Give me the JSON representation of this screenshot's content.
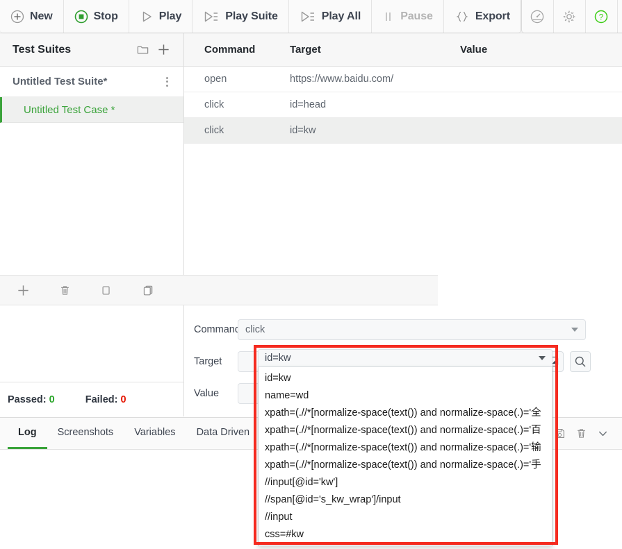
{
  "toolbar": {
    "buttons": [
      {
        "label": "New",
        "icon": "plus-circle-icon",
        "disabled": false
      },
      {
        "label": "Stop",
        "icon": "stop-circle-icon",
        "disabled": false
      },
      {
        "label": "Play",
        "icon": "play-triangle-icon",
        "disabled": false
      },
      {
        "label": "Play Suite",
        "icon": "play-list-icon",
        "disabled": false
      },
      {
        "label": "Play All",
        "icon": "play-list-icon",
        "disabled": false
      },
      {
        "label": "Pause",
        "icon": "pause-icon",
        "disabled": true
      },
      {
        "label": "Export",
        "icon": "braces-icon",
        "disabled": false
      }
    ],
    "right_icons": [
      "speedometer-icon",
      "gear-icon",
      "help-circle-icon",
      "github-icon"
    ],
    "colors": {
      "stop_green": "#3aa33a",
      "help_green": "#3ecd17",
      "label": "#3d4450",
      "disabled": "#b4b4b4"
    }
  },
  "sidebar": {
    "title": "Test Suites",
    "header_icons": [
      "new-folder-icon",
      "add-icon"
    ],
    "suite": {
      "name": "Untitled Test Suite*",
      "menu_icon": "kebab-menu-icon"
    },
    "test_case": {
      "name": "Untitled Test Case *",
      "selected": true,
      "accent": "#3aa33a"
    },
    "status": {
      "passed_label": "Passed:",
      "passed_count": "0",
      "failed_label": "Failed:",
      "failed_count": "0",
      "passed_color": "#2aa52a",
      "failed_color": "#e51400"
    }
  },
  "test_table": {
    "columns": [
      "Command",
      "Target",
      "Value"
    ],
    "rows": [
      {
        "command": "open",
        "target": "https://www.baidu.com/",
        "value": "",
        "selected": false
      },
      {
        "command": "click",
        "target": "id=head",
        "value": "",
        "selected": false
      },
      {
        "command": "click",
        "target": "id=kw",
        "value": "",
        "selected": true
      }
    ],
    "row_actions": [
      "add-command-icon",
      "delete-command-icon",
      "copy-command-icon",
      "paste-command-icon"
    ]
  },
  "form": {
    "command_label": "Command",
    "command_value": "click",
    "target_label": "Target",
    "target_value": "id=kw",
    "value_label": "Value",
    "value_value": "",
    "select_element_icon": "select-element-icon",
    "find_element_icon": "find-element-icon"
  },
  "target_dropdown": {
    "open": true,
    "selected": "id=kw",
    "highlight_color": "#f52b20",
    "options": [
      "id=kw",
      "name=wd",
      "xpath=(.//*[normalize-space(text()) and normalize-space(.)='全",
      "xpath=(.//*[normalize-space(text()) and normalize-space(.)='百",
      "xpath=(.//*[normalize-space(text()) and normalize-space(.)='输",
      "xpath=(.//*[normalize-space(text()) and normalize-space(.)='手",
      "//input[@id='kw']",
      "//span[@id='s_kw_wrap']/input",
      "//input",
      "css=#kw"
    ]
  },
  "bottom_panel": {
    "tabs": [
      {
        "label": "Log",
        "active": true
      },
      {
        "label": "Screenshots",
        "active": false
      },
      {
        "label": "Variables",
        "active": false
      },
      {
        "label": "Data Driven",
        "active": false
      }
    ],
    "actions": [
      "save-log-icon",
      "clear-log-icon",
      "collapse-icon"
    ],
    "log_content": ""
  }
}
